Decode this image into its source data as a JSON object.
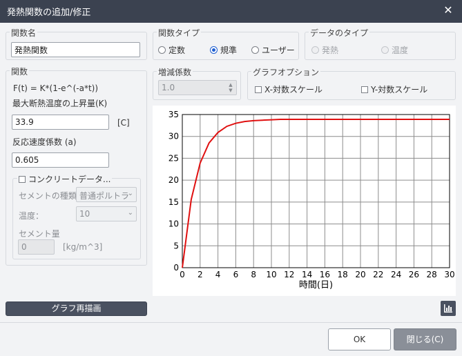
{
  "window": {
    "title": "発熱関数の追加/修正",
    "close_glyph": "✕"
  },
  "function_name": {
    "label": "関数名",
    "value": "発熱関数"
  },
  "function_type": {
    "label": "関数タイプ",
    "options": [
      {
        "label": "定数",
        "selected": false
      },
      {
        "label": "規準",
        "selected": true
      },
      {
        "label": "ユーザー",
        "selected": false
      }
    ]
  },
  "data_type": {
    "label": "データのタイプ",
    "options": [
      {
        "label": "発熱",
        "selected": true,
        "disabled": true
      },
      {
        "label": "温度",
        "selected": false,
        "disabled": true
      }
    ]
  },
  "function": {
    "label": "関数",
    "formula": "F(t)  =  K*(1-e^(-a*t))",
    "max_temp_label": "最大断熱温度の上昇量(K)",
    "max_temp_value": "33.9",
    "max_temp_unit": "[C]",
    "rate_label": "反応速度係数 (a)",
    "rate_value": "0.605",
    "concrete": {
      "checkbox_label": "コンクリートデータ...",
      "cement_type_label": "セメントの種類",
      "cement_type_value": "普通ポルトラ",
      "temp_label": "温度：",
      "temp_value": "10",
      "cement_amount_label": "セメント量",
      "cement_amount_value": "0",
      "cement_amount_unit": "[kg/m^3]"
    }
  },
  "increase_coef": {
    "label": "増減係数",
    "value": "1.0"
  },
  "graph_options": {
    "label": "グラフオプション",
    "x_log": "X-対数スケール",
    "y_log": "Y-対数スケール"
  },
  "buttons": {
    "redraw": "グラフ再描画",
    "ok": "OK",
    "close": "閉じる(C)"
  },
  "icons": {
    "chart": "bar-chart-icon",
    "close": "close-icon",
    "chevron": "chevron-down-icon"
  },
  "colors": {
    "curve": "#e01010",
    "titlebar": "#3b4250"
  },
  "chart_data": {
    "type": "line",
    "xlabel": "時間(日)",
    "ylabel": "",
    "xlim": [
      0,
      30
    ],
    "ylim": [
      0,
      35
    ],
    "xticks": [
      0,
      2,
      4,
      6,
      8,
      10,
      12,
      14,
      16,
      18,
      20,
      22,
      24,
      26,
      28,
      30
    ],
    "yticks": [
      0,
      5,
      10,
      15,
      20,
      25,
      30,
      35
    ],
    "grid": true,
    "series": [
      {
        "x": [
          0,
          1,
          2,
          3,
          4,
          5,
          6,
          7,
          8,
          9,
          10,
          11,
          12,
          13,
          14,
          15,
          16,
          17,
          18,
          19,
          20,
          21,
          22,
          23,
          24,
          25,
          26,
          27,
          28,
          29,
          30
        ],
        "values": [
          0,
          15.6,
          23.9,
          28.5,
          30.9,
          32.3,
          33.0,
          33.4,
          33.6,
          33.7,
          33.8,
          33.9,
          33.9,
          33.9,
          33.9,
          33.9,
          33.9,
          33.9,
          33.9,
          33.9,
          33.9,
          33.9,
          33.9,
          33.9,
          33.9,
          33.9,
          33.9,
          33.9,
          33.9,
          33.9,
          33.9
        ]
      }
    ]
  }
}
